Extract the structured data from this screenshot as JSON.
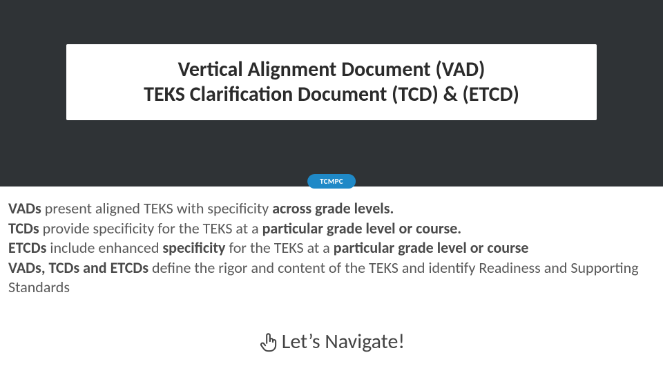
{
  "title": {
    "line1": "Vertical Alignment Document (VAD)",
    "line2": "TEKS Clarification Document (TCD) & (ETCD)"
  },
  "chip": {
    "label": "TCMPC"
  },
  "body": {
    "vads": {
      "strong": "VADs",
      "mid1": " present aligned TEKS with specificity ",
      "strong2": "across grade levels.",
      "tail": ""
    },
    "tcds": {
      "strong": "TCDs",
      "mid1": "  provide specificity for the TEKS at a ",
      "strong2": "particular grade level or course.",
      "tail": ""
    },
    "etcds": {
      "strong": "ETCDs",
      "mid1": " include enhanced ",
      "strong2": "specificity",
      "mid2": " for the TEKS at a ",
      "strong3": "particular grade level or course",
      "tail": ""
    },
    "defs": {
      "strong": "VADs, TCDs and ETCDs",
      "tail": " define the rigor and content of the TEKS and identify Readiness and Supporting Standards"
    }
  },
  "cta": {
    "label": "Let’s Navigate!"
  },
  "icons": {
    "hand": "hand-point-icon"
  }
}
